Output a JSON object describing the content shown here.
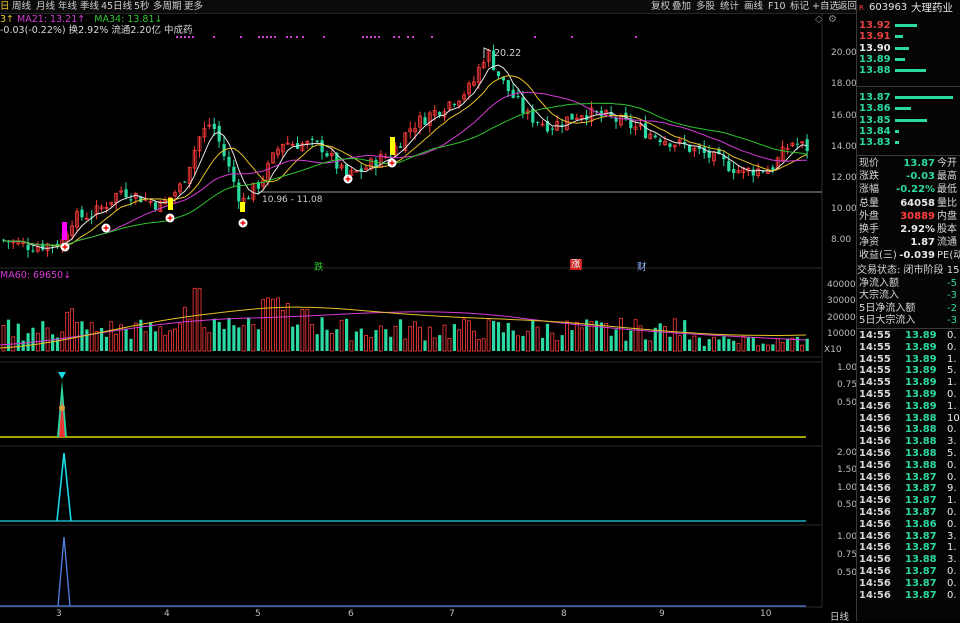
{
  "toolbar": {
    "left_tabs": [
      "周线",
      "月线",
      "年线",
      "季线",
      "45日线",
      "5秒",
      "多周期",
      "更多"
    ],
    "first_fragment": "日",
    "right_tools": [
      "复权",
      "叠加",
      "多股",
      "统计",
      "画线",
      "F10",
      "标记",
      "+自选",
      "返回"
    ],
    "diamond": "◇",
    "gear": "⚙"
  },
  "ma_legend": {
    "ma21": "MA21: 13.21↑",
    "ma34": "MA34: 13.81↓",
    "line2": "-0.03(-0.22%) 换2.92% 流通2.20亿 中成药"
  },
  "annotations": {
    "peak": "20.22",
    "range": "10.96 - 11.08",
    "mark_die": "跌",
    "mark_zhang": "涨",
    "mark_cai": "财"
  },
  "colors": {
    "up": "#ff3b3b",
    "down": "#2bd9a3",
    "ma_white": "#e8e8e8",
    "ma_yellow": "#e6c229",
    "ma_magenta": "#d63bd6",
    "ma_green": "#2fc42f",
    "cyan": "#19d7e6",
    "indicator_yellow": "#d8d800",
    "indicator_blue": "#4f7bd8"
  },
  "price_axis": [
    "20.00",
    "18.00",
    "16.00",
    "14.00",
    "12.00",
    "10.00",
    "8.00"
  ],
  "volume": {
    "label": "MA60: 69650↓",
    "axis": [
      "40000",
      "30000",
      "20000",
      "10000"
    ],
    "unit": "X10"
  },
  "ind1_axis": [
    "1.00",
    "0.75",
    "0.50"
  ],
  "ind2_axis": [
    "2.00",
    "1.50",
    "1.00",
    "0.50"
  ],
  "ind3_axis": [
    "1.00",
    "0.75",
    "0.50"
  ],
  "time_axis": [
    "3",
    "4",
    "5",
    "6",
    "7",
    "8",
    "9",
    "10"
  ],
  "period_label": "日线",
  "stock": {
    "badge": "R",
    "code": "603963",
    "name": "大理药业",
    "sell_levels": [
      {
        "price": "13.92",
        "bar": 0.35
      },
      {
        "price": "13.91",
        "bar": 0.12
      },
      {
        "price": "13.90",
        "bar": 0.22
      },
      {
        "price": "13.89",
        "bar": 0.16
      },
      {
        "price": "13.88",
        "bar": 0.48
      }
    ],
    "buy_levels": [
      {
        "price": "13.87",
        "bar": 0.9
      },
      {
        "price": "13.86",
        "bar": 0.25
      },
      {
        "price": "13.85",
        "bar": 0.5
      },
      {
        "price": "13.84",
        "bar": 0.06
      },
      {
        "price": "13.83",
        "bar": 0.07
      }
    ],
    "quotes": [
      {
        "label": "现价",
        "value": "13.87",
        "extra": "今开"
      },
      {
        "label": "涨跌",
        "value": "-0.03",
        "extra": "最高"
      },
      {
        "label": "涨幅",
        "value": "-0.22%",
        "extra": "最低"
      },
      {
        "label": "总量",
        "value": "64058",
        "extra": "量比"
      },
      {
        "label": "外盘",
        "value": "30889",
        "extra": "内盘"
      },
      {
        "label": "换手",
        "value": "2.92%",
        "extra": "股本"
      },
      {
        "label": "净资",
        "value": "1.87",
        "extra": "流通"
      },
      {
        "label": "收益(三)",
        "value": "-0.039",
        "extra": "PE(动)"
      }
    ],
    "trade_status": "交易状态: 闭市阶段 15",
    "flows": [
      {
        "label": "净流入额",
        "value": "-5"
      },
      {
        "label": "大宗流入",
        "value": "-3"
      },
      {
        "label": "5日净流入额",
        "value": "-2"
      },
      {
        "label": "5日大宗流入",
        "value": "-3"
      }
    ],
    "ticks": [
      {
        "t": "14:55",
        "p": "13.89",
        "v": "0."
      },
      {
        "t": "14:55",
        "p": "13.89",
        "v": "0."
      },
      {
        "t": "14:55",
        "p": "13.89",
        "v": "1."
      },
      {
        "t": "14:55",
        "p": "13.89",
        "v": "5."
      },
      {
        "t": "14:55",
        "p": "13.89",
        "v": "1."
      },
      {
        "t": "14:55",
        "p": "13.89",
        "v": "0."
      },
      {
        "t": "14:56",
        "p": "13.89",
        "v": "1."
      },
      {
        "t": "14:56",
        "p": "13.88",
        "v": "10."
      },
      {
        "t": "14:56",
        "p": "13.88",
        "v": "0."
      },
      {
        "t": "14:56",
        "p": "13.88",
        "v": "3."
      },
      {
        "t": "14:56",
        "p": "13.88",
        "v": "5."
      },
      {
        "t": "14:56",
        "p": "13.88",
        "v": "0."
      },
      {
        "t": "14:56",
        "p": "13.87",
        "v": "0."
      },
      {
        "t": "14:56",
        "p": "13.87",
        "v": "9."
      },
      {
        "t": "14:56",
        "p": "13.87",
        "v": "1."
      },
      {
        "t": "14:56",
        "p": "13.87",
        "v": "0."
      },
      {
        "t": "14:56",
        "p": "13.86",
        "v": "0."
      },
      {
        "t": "14:56",
        "p": "13.87",
        "v": "3."
      },
      {
        "t": "14:56",
        "p": "13.87",
        "v": "1."
      },
      {
        "t": "14:56",
        "p": "13.88",
        "v": "3."
      },
      {
        "t": "14:56",
        "p": "13.87",
        "v": "0."
      },
      {
        "t": "14:56",
        "p": "13.87",
        "v": "0."
      },
      {
        "t": "14:56",
        "p": "13.87",
        "v": "0."
      }
    ]
  }
}
